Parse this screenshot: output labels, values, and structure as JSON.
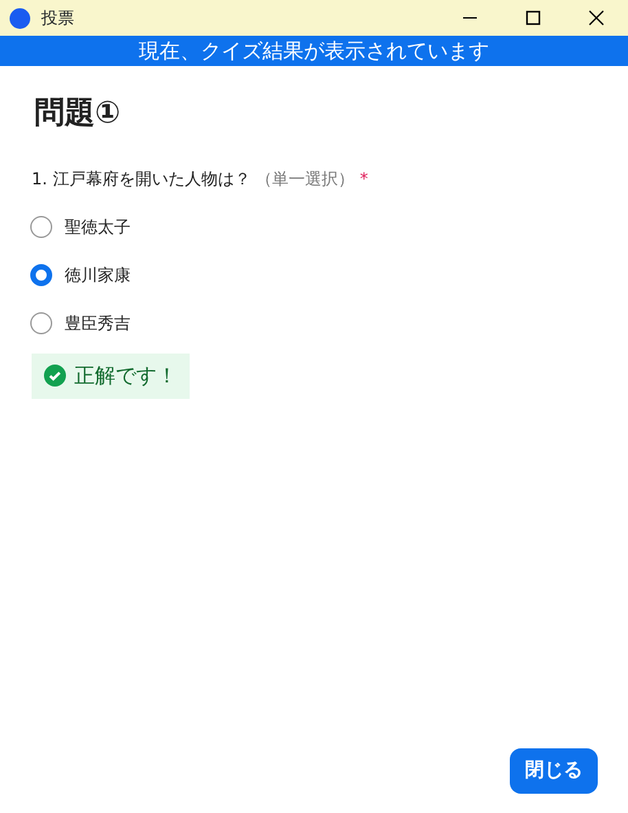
{
  "window": {
    "title": "投票"
  },
  "banner": "現在、クイズ結果が表示されています",
  "heading": "問題①",
  "question": {
    "number": "1.",
    "text": "江戸幕府を開いた人物は？",
    "type": "（単一選択）",
    "required": "*"
  },
  "options": [
    {
      "label": "聖徳太子",
      "selected": false
    },
    {
      "label": "徳川家康",
      "selected": true
    },
    {
      "label": "豊臣秀吉",
      "selected": false
    }
  ],
  "result": {
    "text": "正解です！",
    "correct": true
  },
  "buttons": [
    "閉じる"
  ]
}
